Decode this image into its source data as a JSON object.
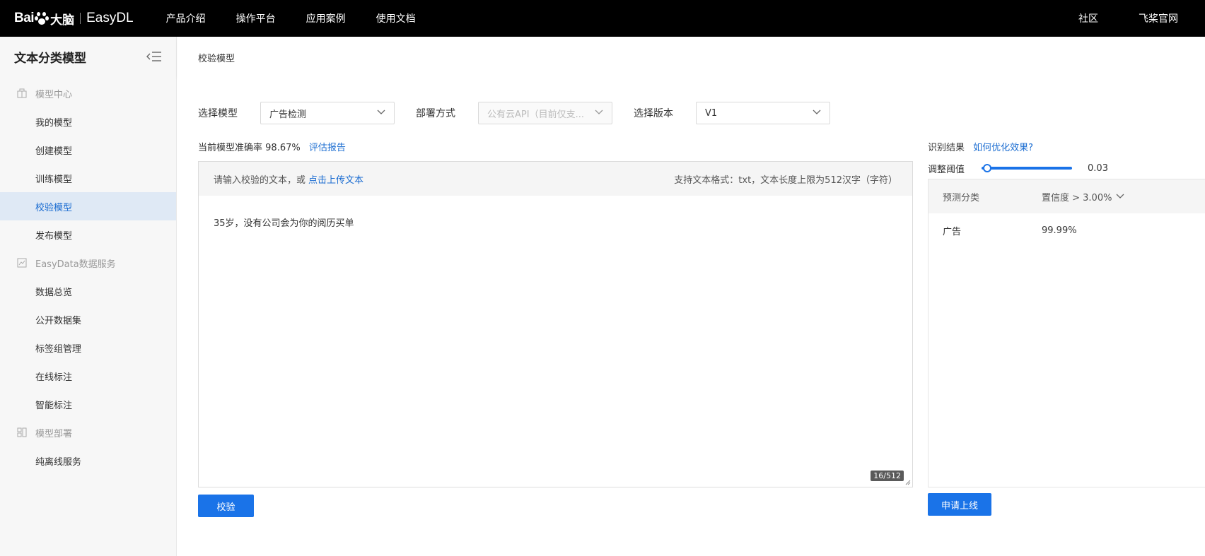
{
  "topbar": {
    "logo_bai": "Bai",
    "logo_du": "大脑",
    "logo_product": "EasyDL",
    "nav": [
      "产品介绍",
      "操作平台",
      "应用案例",
      "使用文档"
    ],
    "nav_right": [
      "社区",
      "飞桨官网"
    ]
  },
  "sidebar": {
    "title": "文本分类模型",
    "groups": [
      {
        "label": "模型中心",
        "items": [
          "我的模型",
          "创建模型",
          "训练模型",
          "校验模型",
          "发布模型"
        ]
      },
      {
        "label": "EasyData数据服务",
        "items": [
          "数据总览",
          "公开数据集",
          "标签组管理",
          "在线标注",
          "智能标注"
        ]
      },
      {
        "label": "模型部署",
        "items": [
          "纯离线服务"
        ]
      }
    ],
    "active_item": "校验模型"
  },
  "breadcrumb": "校验模型",
  "selectors": {
    "model_label": "选择模型",
    "model_value": "广告检测",
    "deploy_label": "部署方式",
    "deploy_value": "公有云API（目前仅支...",
    "version_label": "选择版本",
    "version_value": "V1"
  },
  "accuracy": {
    "label": "当前模型准确率",
    "value": "98.67%",
    "report_link": "评估报告"
  },
  "input": {
    "prompt": "请输入校验的文本，或",
    "upload_link": "点击上传文本",
    "hint": "支持文本格式：txt，文本长度上限为512汉字（字符）",
    "content": "35岁，没有公司会为你的阅历买单",
    "counter": "16/512"
  },
  "verify_button": "校验",
  "result": {
    "title": "识别结果",
    "optimize_link": "如何优化效果?",
    "threshold_label": "调整阈值",
    "threshold_value": "0.03",
    "threshold_fraction": 0.03,
    "col_category": "预测分类",
    "col_confidence": "置信度 > 3.00%",
    "rows": [
      {
        "category": "广告",
        "confidence": "99.99%"
      }
    ]
  },
  "apply_button": "申请上线",
  "colors": {
    "accent": "#1a73e8",
    "link": "#1a6cd1",
    "topbar": "#000000"
  }
}
